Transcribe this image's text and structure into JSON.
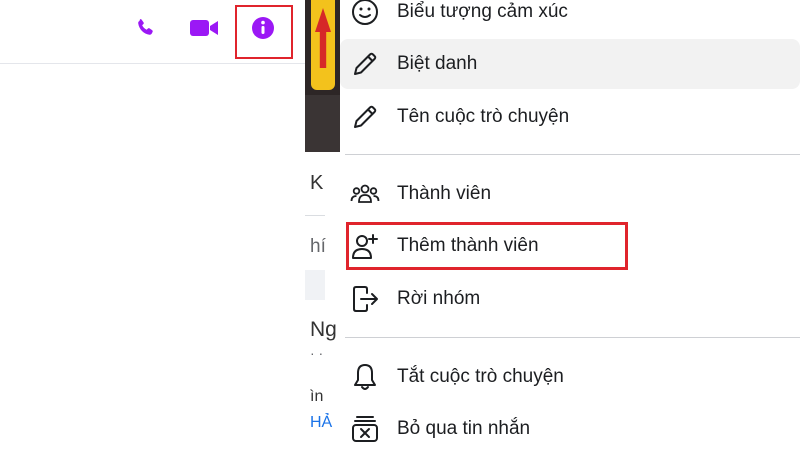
{
  "header": {
    "icons": [
      "phone-icon",
      "video-camera-icon",
      "info-icon"
    ],
    "accent_color": "#9b18f5"
  },
  "sliver": {
    "texts": [
      "K",
      "hí",
      "Ng",
      "· ·",
      "ìn",
      "HẢ"
    ]
  },
  "menu": {
    "items": [
      {
        "label": "Biểu tượng cảm xúc",
        "icon": "smiley-icon"
      },
      {
        "label": "Biệt danh",
        "icon": "pencil-icon"
      },
      {
        "label": "Tên cuộc trò chuyện",
        "icon": "pencil-icon"
      },
      {
        "label": "Thành viên",
        "icon": "people-icon"
      },
      {
        "label": "Thêm thành viên",
        "icon": "add-person-icon"
      },
      {
        "label": "Rời nhóm",
        "icon": "leave-icon"
      },
      {
        "label": "Tắt cuộc trò chuyện",
        "icon": "bell-icon"
      },
      {
        "label": "Bỏ qua tin nhắn",
        "icon": "ignore-box-icon"
      }
    ]
  },
  "highlight_color": "#e0242c"
}
